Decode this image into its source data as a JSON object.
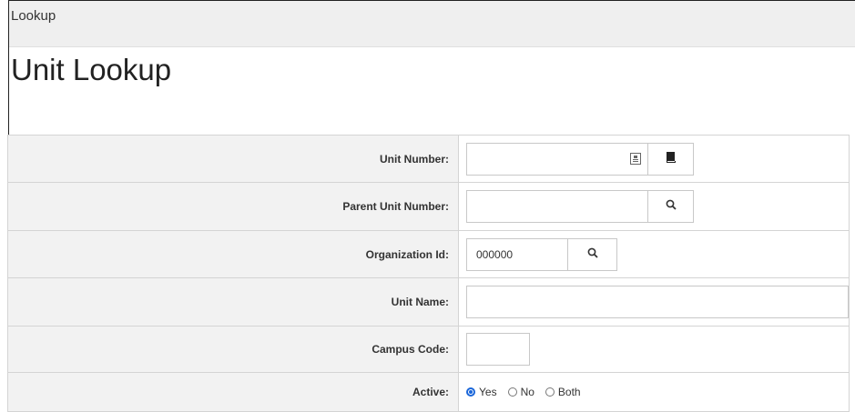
{
  "header": {
    "section_label": "Lookup"
  },
  "page": {
    "title": "Unit Lookup"
  },
  "form": {
    "unit_number": {
      "label": "Unit Number:",
      "value": ""
    },
    "parent_unit_number": {
      "label": "Parent Unit Number:",
      "value": ""
    },
    "organization_id": {
      "label": "Organization Id:",
      "value": "000000"
    },
    "unit_name": {
      "label": "Unit Name:",
      "value": ""
    },
    "campus_code": {
      "label": "Campus Code:",
      "value": ""
    },
    "active": {
      "label": "Active:",
      "options": [
        "Yes",
        "No",
        "Both"
      ],
      "selected": "Yes"
    }
  },
  "icons": {
    "unit_number_inner": "id-card-icon",
    "unit_number_button": "book-icon",
    "search": "search-icon"
  },
  "colors": {
    "radio_selected": "#1a66d9",
    "label_bg": "#f2f2f2",
    "topbar_bg": "#efefef"
  }
}
